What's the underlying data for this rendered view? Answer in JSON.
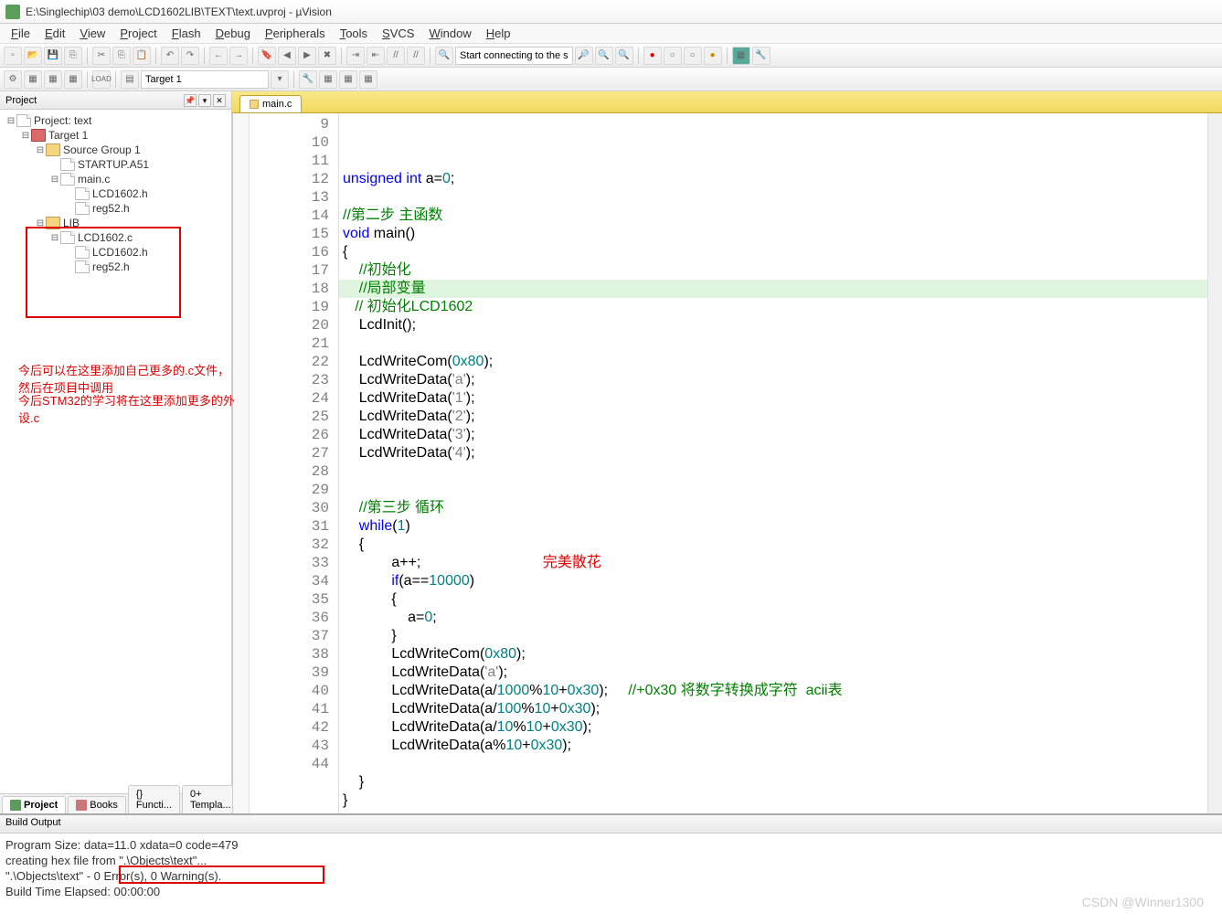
{
  "window": {
    "title": "E:\\Singlechip\\03 demo\\LCD1602LIB\\TEXT\\text.uvproj - µVision"
  },
  "menu": [
    "File",
    "Edit",
    "View",
    "Project",
    "Flash",
    "Debug",
    "Peripherals",
    "Tools",
    "SVCS",
    "Window",
    "Help"
  ],
  "toolbar2": {
    "target": "Target 1",
    "search": "Start connecting to the s"
  },
  "project_panel": {
    "title": "Project",
    "root": "Project: text",
    "target": "Target 1",
    "group1": "Source Group 1",
    "files1": [
      "STARTUP.A51",
      "main.c",
      "LCD1602.h",
      "reg52.h"
    ],
    "group2": "LIB",
    "files2": [
      "LCD1602.c",
      "LCD1602.h",
      "reg52.h"
    ],
    "tabs": [
      "Project",
      "Books",
      "{} Functi...",
      "0+ Templa..."
    ]
  },
  "annotations": {
    "line1": "今后可以在这里添加自己更多的.c文件，然后在项目中调用",
    "line2": "今后STM32的学习将在这里添加更多的外设.c",
    "right": "完美散花"
  },
  "editor": {
    "tab": "main.c",
    "first_line": 9,
    "highlight_line": 18,
    "lines": [
      {
        "n": 9,
        "html": "<span class='kw'>unsigned</span> <span class='kw'>int</span> a=<span class='num'>0</span>;"
      },
      {
        "n": 10,
        "html": ""
      },
      {
        "n": 11,
        "html": "<span class='cmt'>//第二步 主函数</span>"
      },
      {
        "n": 12,
        "html": "<span class='kw'>void</span> main()"
      },
      {
        "n": 13,
        "html": "{"
      },
      {
        "n": 14,
        "html": "    <span class='cmt'>//初始化</span>"
      },
      {
        "n": 15,
        "html": "    <span class='cmt'>//局部变量</span>"
      },
      {
        "n": 16,
        "html": "   <span class='cmt'>// 初始化LCD1602</span>"
      },
      {
        "n": 17,
        "html": "    LcdInit();"
      },
      {
        "n": 18,
        "html": "    "
      },
      {
        "n": 19,
        "html": "    LcdWriteCom(<span class='num'>0x80</span>);"
      },
      {
        "n": 20,
        "html": "    LcdWriteData(<span class='str'>'a'</span>);"
      },
      {
        "n": 21,
        "html": "    LcdWriteData(<span class='str'>'1'</span>);"
      },
      {
        "n": 22,
        "html": "    LcdWriteData(<span class='str'>'2'</span>);"
      },
      {
        "n": 23,
        "html": "    LcdWriteData(<span class='str'>'3'</span>);"
      },
      {
        "n": 24,
        "html": "    LcdWriteData(<span class='str'>'4'</span>);"
      },
      {
        "n": 25,
        "html": ""
      },
      {
        "n": 26,
        "html": ""
      },
      {
        "n": 27,
        "html": "    <span class='cmt'>//第三步 循环</span>"
      },
      {
        "n": 28,
        "html": "    <span class='kw'>while</span>(<span class='num'>1</span>)"
      },
      {
        "n": 29,
        "html": "    {"
      },
      {
        "n": 30,
        "html": "            a++;                              <span class='red-inline'>完美散花</span>"
      },
      {
        "n": 31,
        "html": "            <span class='kw'>if</span>(a==<span class='num'>10000</span>)"
      },
      {
        "n": 32,
        "html": "            {"
      },
      {
        "n": 33,
        "html": "                a=<span class='num'>0</span>;"
      },
      {
        "n": 34,
        "html": "            }"
      },
      {
        "n": 35,
        "html": "            LcdWriteCom(<span class='num'>0x80</span>);"
      },
      {
        "n": 36,
        "html": "            LcdWriteData(<span class='str'>'a'</span>);"
      },
      {
        "n": 37,
        "html": "            LcdWriteData(a/<span class='num'>1000</span>%<span class='num'>10</span>+<span class='num'>0x30</span>);     <span class='cmt'>//+0x30 将数字转换成字符  acii表</span>"
      },
      {
        "n": 38,
        "html": "            LcdWriteData(a/<span class='num'>100</span>%<span class='num'>10</span>+<span class='num'>0x30</span>);"
      },
      {
        "n": 39,
        "html": "            LcdWriteData(a/<span class='num'>10</span>%<span class='num'>10</span>+<span class='num'>0x30</span>);"
      },
      {
        "n": 40,
        "html": "            LcdWriteData(a%<span class='num'>10</span>+<span class='num'>0x30</span>);"
      },
      {
        "n": 41,
        "html": ""
      },
      {
        "n": 42,
        "html": "    }"
      },
      {
        "n": 43,
        "html": "}"
      },
      {
        "n": 44,
        "html": ""
      }
    ]
  },
  "build": {
    "title": "Build Output",
    "lines": [
      "Program Size: data=11.0 xdata=0 code=479",
      "creating hex file from \".\\Objects\\text\"...",
      "\".\\Objects\\text\" - 0 Error(s), 0 Warning(s).",
      "Build Time Elapsed:  00:00:00"
    ],
    "highlight": "0 Error(s), 0 Warning(s)."
  },
  "watermark": "CSDN @Winner1300"
}
